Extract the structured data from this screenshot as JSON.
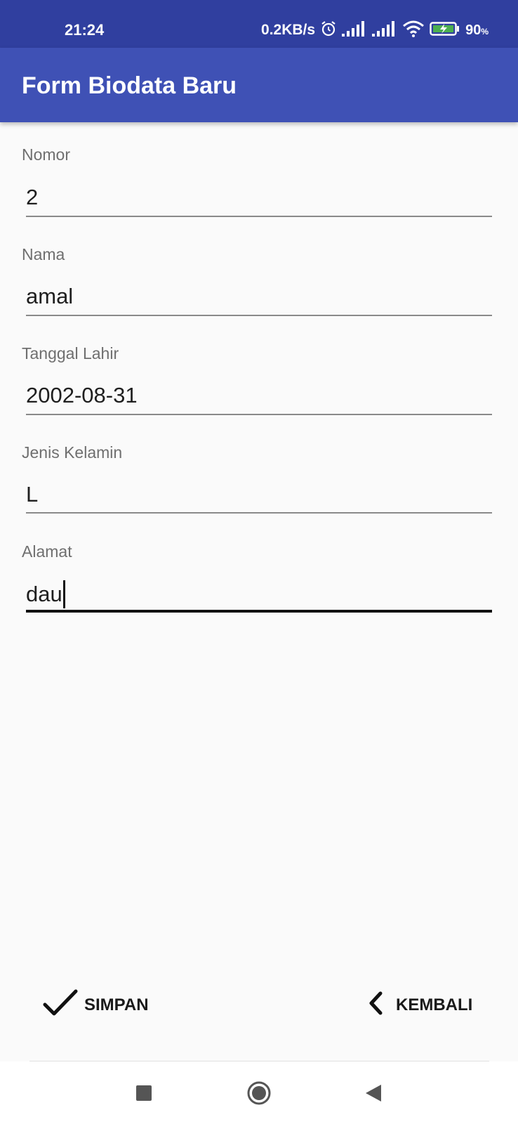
{
  "status_bar": {
    "time": "21:24",
    "net_speed": "0.2KB/s",
    "battery_percent": "90",
    "battery_unit": "%",
    "icons": [
      "alarm-icon",
      "signal-icon",
      "signal-icon",
      "wifi-icon",
      "battery-charging-icon"
    ]
  },
  "app_bar": {
    "title": "Form Biodata Baru"
  },
  "form": {
    "fields": [
      {
        "label": "Nomor",
        "value": "2"
      },
      {
        "label": "Nama",
        "value": "amal"
      },
      {
        "label": "Tanggal Lahir",
        "value": "2002-08-31"
      },
      {
        "label": "Jenis Kelamin",
        "value": "L"
      },
      {
        "label": "Alamat",
        "value": "dau"
      }
    ],
    "focused_field": "Alamat"
  },
  "actions": {
    "save_label": "SIMPAN",
    "save_icon": "check-icon",
    "back_label": "KEMBALI",
    "back_icon": "chevron-left-icon"
  },
  "nav_bar": {
    "buttons": [
      "recents-icon",
      "home-icon",
      "back-icon"
    ]
  },
  "colors": {
    "status_bar": "#303f9f",
    "app_bar": "#3f51b5",
    "background": "#fafafa",
    "battery_fill": "#4caf50"
  }
}
